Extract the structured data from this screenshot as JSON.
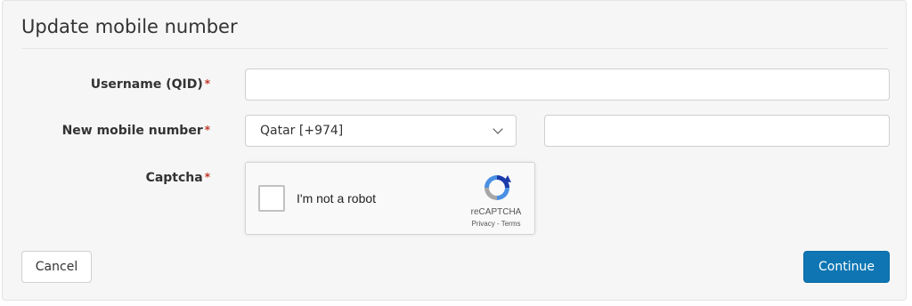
{
  "form": {
    "title": "Update mobile number",
    "required_marker": "*",
    "username": {
      "label": "Username (QID)",
      "value": "",
      "placeholder": ""
    },
    "mobile": {
      "label": "New mobile number",
      "country_selected": "Qatar [+974]",
      "number_value": "",
      "number_placeholder": ""
    },
    "captcha": {
      "label": "Captcha",
      "checkbox_text": "I'm not a robot",
      "brand": "reCAPTCHA",
      "links": "Privacy - Terms"
    }
  },
  "actions": {
    "cancel_label": "Cancel",
    "continue_label": "Continue"
  },
  "colors": {
    "primary_button": "#0f76b3",
    "required": "#c0392b",
    "panel_bg": "#f6f6f6"
  },
  "icons": [
    "chevron-down-icon",
    "recaptcha-logo-icon"
  ]
}
